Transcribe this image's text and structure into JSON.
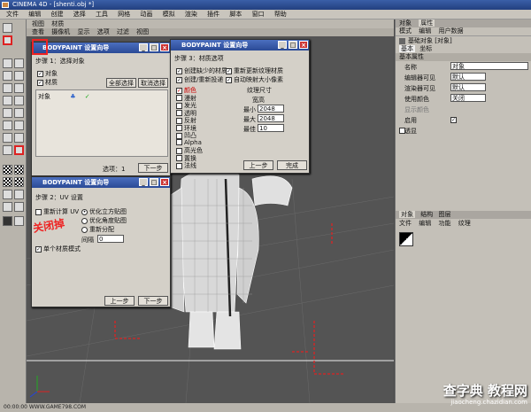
{
  "window": {
    "title": "CINEMA 4D - [shenti.obj *]"
  },
  "menubar": [
    "文件",
    "编辑",
    "创建",
    "选择",
    "工具",
    "网格",
    "动画",
    "模拟",
    "渲染",
    "插件",
    "脚本",
    "窗口",
    "帮助"
  ],
  "viewport": {
    "tabs": [
      "视图",
      "材质"
    ],
    "menu": [
      "查看",
      "摄像机",
      "显示",
      "选项",
      "过滤",
      "视图"
    ]
  },
  "right_panel": {
    "tabs": [
      "对象",
      "属性"
    ],
    "subtabs": [
      "模式",
      "编辑",
      "用户数据"
    ],
    "object_title": "基础对象 [对象]",
    "basic_tabs": [
      "基本",
      "坐标"
    ],
    "section": "基本属性",
    "fields": [
      {
        "label": "名称",
        "value": "对象"
      },
      {
        "label": "编辑器可见",
        "value": "默认"
      },
      {
        "label": "渲染器可见",
        "value": "默认"
      },
      {
        "label": "使用颜色",
        "value": "关闭"
      },
      {
        "label": "显示颜色",
        "value": ""
      },
      {
        "label": "启用",
        "value": "✓"
      },
      {
        "label": "透显",
        "value": ""
      }
    ],
    "lower_tabs": [
      "对象",
      "结构",
      "图层"
    ],
    "lower_menu": [
      "文件",
      "编辑",
      "功能",
      "纹理"
    ]
  },
  "dialog1": {
    "title": "BODYPAINT 设置向导",
    "step": "步骤 1：选择对象",
    "options": [
      "对象",
      "材质"
    ],
    "buttons": [
      "全部选择",
      "取消选择"
    ],
    "object_item": "对象",
    "selection": "选项：1",
    "next": "下一步"
  },
  "dialog2": {
    "title": "BODYPAINT 设置向导",
    "step": "步骤 3：材质选项",
    "check1": "创建缺少的材质",
    "check2": "创建/重新投递",
    "check3": "重新更新纹理材质",
    "check4": "自动映射大小像素",
    "channels": [
      "颜色",
      "漫射",
      "发光",
      "透明",
      "反射",
      "环境",
      "凹凸",
      "Alpha",
      "高光色",
      "置换",
      "法线"
    ],
    "texture_size_title": "纹理尺寸",
    "size_label": "宽高",
    "min_label": "最小",
    "min_value": "2048",
    "max_label": "最大",
    "max_value": "2048",
    "ratio_label": "最佳",
    "ratio_value": "10",
    "prev": "上一步",
    "finish": "完成"
  },
  "dialog3": {
    "title": "BODYPAINT 设置向导",
    "step": "步骤 2：UV 设置",
    "check_recalc": "重新计算 UV",
    "opt1": "优化立方贴图",
    "opt2": "优化角度贴图",
    "opt3": "重新分配",
    "spacing_label": "间隔",
    "spacing_value": "0",
    "single_material": "单个材质模式",
    "prev": "上一步",
    "next": "下一步"
  },
  "annotation": "关闭掉",
  "status": "00:00:00 WWW.GAME798.COM",
  "watermark": "查字典 教程网",
  "watermark_url": "jiaocheng.chazidian.com"
}
